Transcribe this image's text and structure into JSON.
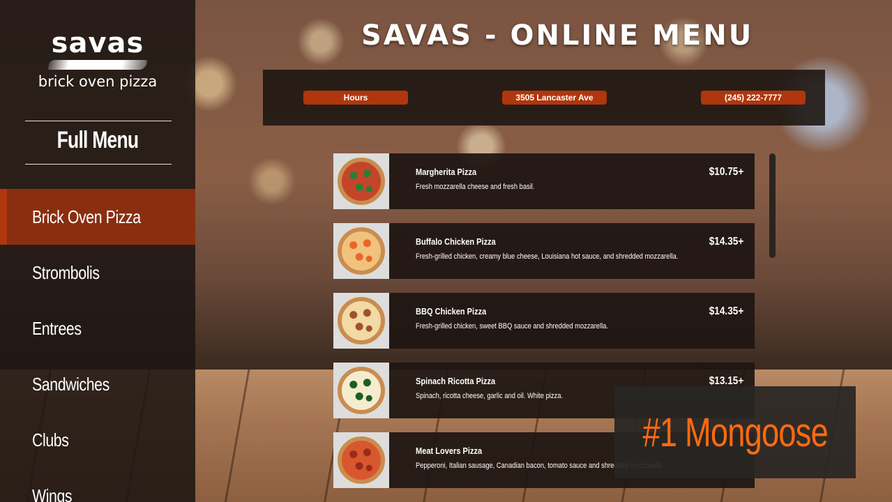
{
  "brand": {
    "name": "savas",
    "tagline": "brick oven pizza"
  },
  "sidebar": {
    "heading": "Full Menu",
    "items": [
      {
        "label": "Brick Oven Pizza",
        "active": true
      },
      {
        "label": "Strombolis",
        "active": false
      },
      {
        "label": "Entrees",
        "active": false
      },
      {
        "label": "Sandwiches",
        "active": false
      },
      {
        "label": "Clubs",
        "active": false
      },
      {
        "label": "Wings",
        "active": false
      }
    ]
  },
  "header": {
    "title": "SAVAS - ONLINE MENU"
  },
  "info_bar": {
    "hours_label": "Hours",
    "address": "3505 Lancaster Ave",
    "phone": "(245) 222-7777"
  },
  "menu_items": [
    {
      "name": "Margherita Pizza",
      "description": "Fresh mozzarella cheese and fresh basil.",
      "price": "$10.75+",
      "topping_color": "#2e7d32",
      "sauce_color": "#c4452a"
    },
    {
      "name": "Buffalo Chicken Pizza",
      "description": "Fresh-grilled chicken, creamy blue cheese, Louisiana hot sauce, and shredded mozzarella.",
      "price": "$14.35+",
      "topping_color": "#e8662a",
      "sauce_color": "#f1c27d"
    },
    {
      "name": "BBQ Chicken Pizza",
      "description": "Fresh-grilled chicken, sweet BBQ sauce and shredded mozzarella.",
      "price": "$14.35+",
      "topping_color": "#a0522d",
      "sauce_color": "#f3d9a4"
    },
    {
      "name": "Spinach Ricotta Pizza",
      "description": "Spinach, ricotta cheese, garlic and oil. White pizza.",
      "price": "$13.15+",
      "topping_color": "#1b5e20",
      "sauce_color": "#f5ecd0"
    },
    {
      "name": "Meat Lovers Pizza",
      "description": "Pepperoni, Italian sausage, Canadian bacon, tomato sauce and shredded mozzarella.",
      "price": "",
      "topping_color": "#9b2a1a",
      "sauce_color": "#d9572e"
    }
  ],
  "overlay": {
    "text": "#1 Mongoose"
  },
  "colors": {
    "accent": "#b0360d",
    "sidebar_active": "#8a2e10",
    "overlay_text": "#ff6a10"
  }
}
